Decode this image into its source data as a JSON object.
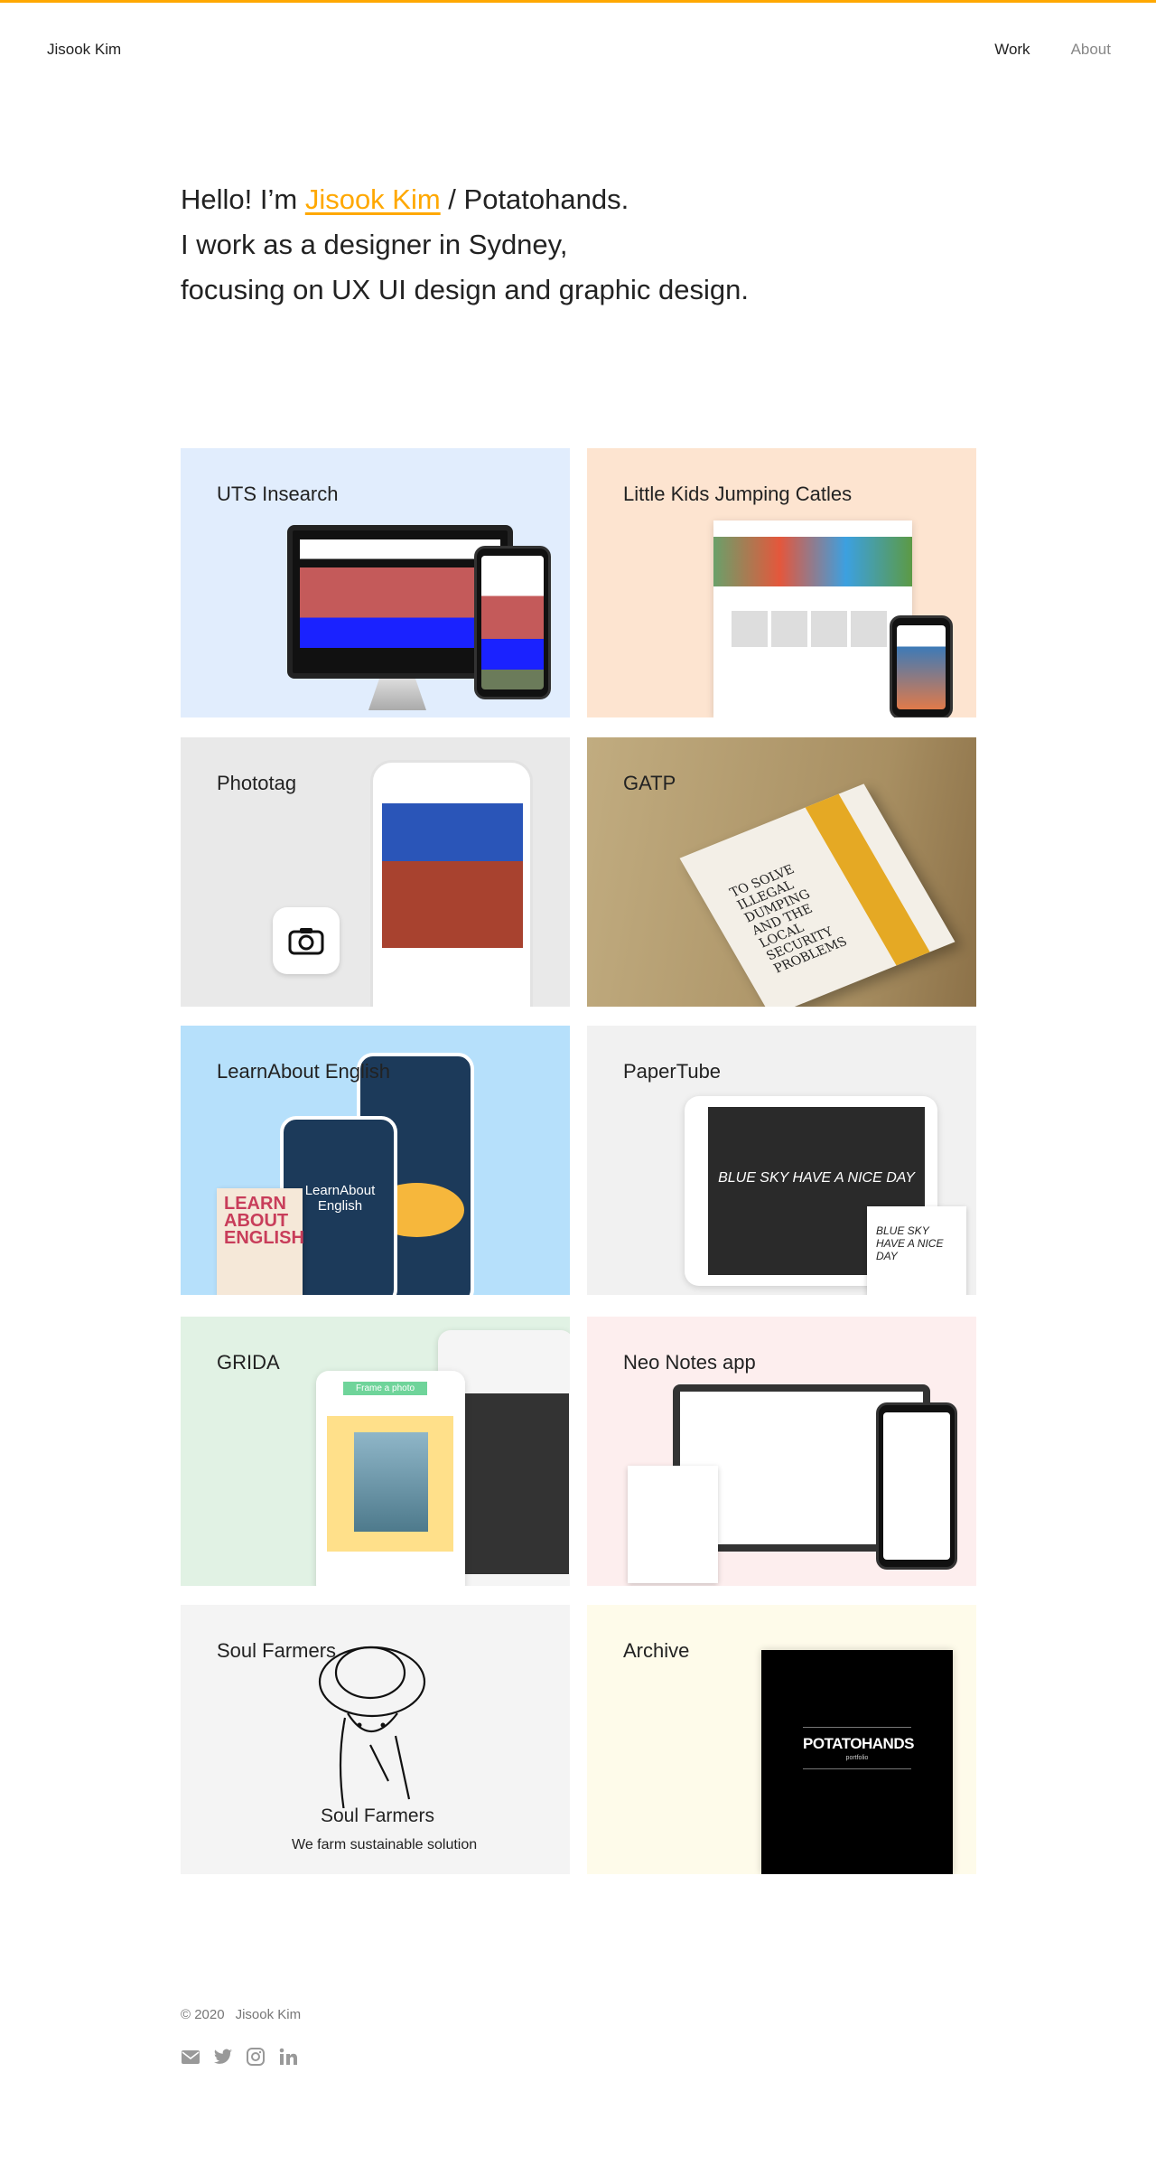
{
  "header": {
    "brand": "Jisook Kim",
    "nav": [
      {
        "label": "Work",
        "active": true
      },
      {
        "label": "About",
        "active": false
      }
    ],
    "accent_color": "#ffa800"
  },
  "hero": {
    "line1_prefix": "Hello! I’m ",
    "name_link": "Jisook Kim",
    "line1_suffix": " / Potatohands.",
    "line2": "I work as a designer in Sydney,",
    "line3": "focusing on UX UI design and graphic design."
  },
  "projects": [
    {
      "title": "UTS Insearch",
      "bg": "#e1edfd"
    },
    {
      "title": "Little Kids Jumping Catles",
      "bg": "#fde4d0"
    },
    {
      "title": "Phototag",
      "bg": "#e9e9e9"
    },
    {
      "title": "GATP",
      "bg": "#b39b6e",
      "book_text": "TO SOLVE ILLEGAL DUMPING AND THE LOCAL SECURITY PROBLEMS"
    },
    {
      "title": "LearnAbout English",
      "bg": "#b6e0fb",
      "app_name": "LearnAbout English",
      "book_text": "LEARN ABOUT ENGLISH"
    },
    {
      "title": "PaperTube",
      "bg": "#f1f1f1",
      "screen_text": "BLUE SKY HAVE A NICE DAY"
    },
    {
      "title": "GRIDA",
      "bg": "#e1f2e4",
      "banner": "Frame a photo"
    },
    {
      "title": "Neo Notes app",
      "bg": "#fdeeee"
    },
    {
      "title": "Soul Farmers",
      "bg": "#f4f4f4",
      "logo_name": "Soul Farmers",
      "tagline": "We farm sustainable solution"
    },
    {
      "title": "Archive",
      "bg": "#fefbea",
      "cover_title": "POTATOHANDS",
      "cover_subtitle": "portfolio"
    }
  ],
  "footer": {
    "copyright": "© 2020",
    "name": "Jisook Kim",
    "social": [
      "mail-icon",
      "twitter-icon",
      "instagram-icon",
      "linkedin-icon"
    ],
    "icon_color": "#999999"
  }
}
